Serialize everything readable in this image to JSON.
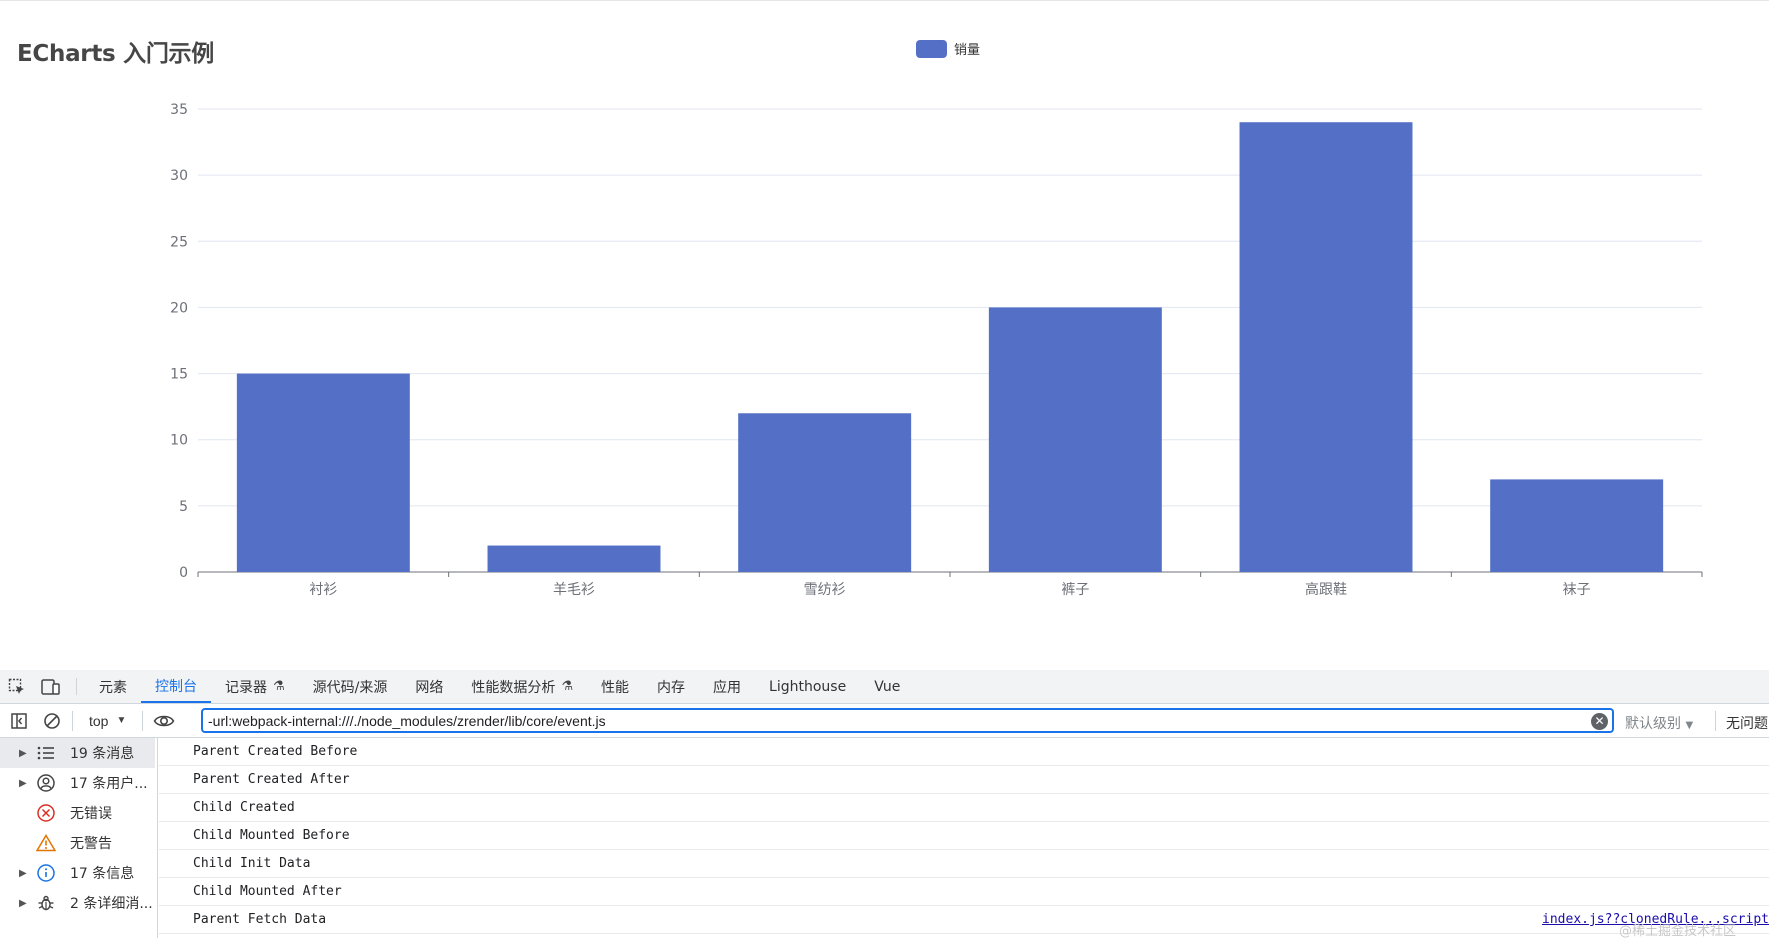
{
  "chart": {
    "title": "ECharts 入门示例",
    "legend_label": "销量"
  },
  "chart_data": {
    "type": "bar",
    "title": "ECharts 入门示例",
    "categories": [
      "衬衫",
      "羊毛衫",
      "雪纺衫",
      "裤子",
      "高跟鞋",
      "袜子"
    ],
    "series": [
      {
        "name": "销量",
        "values": [
          15,
          2,
          12,
          20,
          34,
          7
        ],
        "color": "#5470c6"
      }
    ],
    "ylim": [
      0,
      35
    ],
    "yticks": [
      0,
      5,
      10,
      15,
      20,
      25,
      30,
      35
    ],
    "grid": true,
    "legend": "top-center"
  },
  "devtools": {
    "tabs": [
      {
        "label": "元素",
        "active": false,
        "flask": false
      },
      {
        "label": "控制台",
        "active": true,
        "flask": false
      },
      {
        "label": "记录器",
        "active": false,
        "flask": true
      },
      {
        "label": "源代码/来源",
        "active": false,
        "flask": false
      },
      {
        "label": "网络",
        "active": false,
        "flask": false
      },
      {
        "label": "性能数据分析",
        "active": false,
        "flask": true
      },
      {
        "label": "性能",
        "active": false,
        "flask": false
      },
      {
        "label": "内存",
        "active": false,
        "flask": false
      },
      {
        "label": "应用",
        "active": false,
        "flask": false
      },
      {
        "label": "Lighthouse",
        "active": false,
        "flask": false
      },
      {
        "label": "Vue",
        "active": false,
        "flask": false
      }
    ],
    "toolbar": {
      "context": "top",
      "filter_value": "-url:webpack-internal:///./node_modules/zrender/lib/core/event.js",
      "level": "默认级别",
      "issues": "无问题"
    },
    "sidebar": [
      {
        "label": "19 条消息",
        "icon": "list-icon",
        "arrow": true,
        "selected": true,
        "color": "#444444"
      },
      {
        "label": "17 条用户...",
        "icon": "user-icon",
        "arrow": true,
        "selected": false,
        "color": "#444444"
      },
      {
        "label": "无错误",
        "icon": "error-icon",
        "arrow": false,
        "selected": false,
        "color": "#d93025"
      },
      {
        "label": "无警告",
        "icon": "warning-icon",
        "arrow": false,
        "selected": false,
        "color": "#e37400"
      },
      {
        "label": "17 条信息",
        "icon": "info-icon",
        "arrow": true,
        "selected": false,
        "color": "#1a73e8"
      },
      {
        "label": "2 条详细消...",
        "icon": "bug-icon",
        "arrow": true,
        "selected": false,
        "color": "#444444"
      }
    ],
    "logs": [
      "Parent Created Before",
      "Parent Created After",
      "Child Created",
      "Child Mounted Before",
      "Child Init Data",
      "Child Mounted After",
      "Parent Fetch Data"
    ],
    "last_log_source": "index.js??clonedRule...script",
    "watermark": "@稀土掘金技术社区"
  }
}
